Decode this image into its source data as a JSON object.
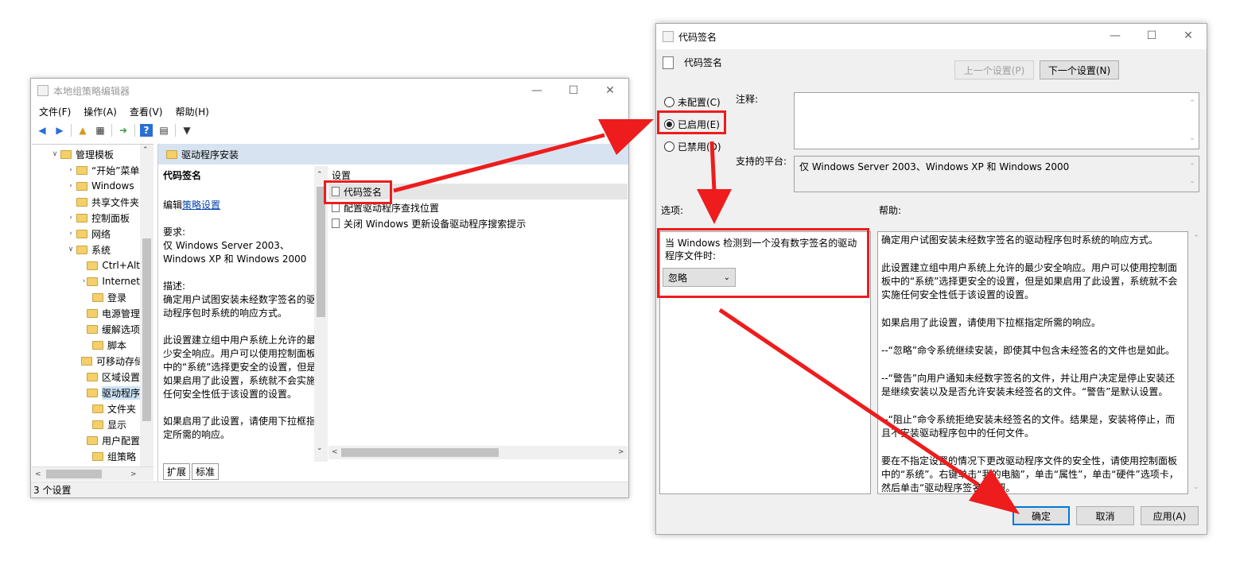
{
  "gpe": {
    "title": "本地组策略编辑器",
    "menu": [
      "文件(F)",
      "操作(A)",
      "查看(V)",
      "帮助(H)"
    ],
    "tree": [
      {
        "label": "管理模板",
        "arrow": "v",
        "level": 0
      },
      {
        "label": "“开始”菜单",
        "arrow": ">",
        "level": 1
      },
      {
        "label": "Windows",
        "arrow": ">",
        "level": 1
      },
      {
        "label": "共享文件夹",
        "arrow": "",
        "level": 1
      },
      {
        "label": "控制面板",
        "arrow": ">",
        "level": 1
      },
      {
        "label": "网络",
        "arrow": ">",
        "level": 1
      },
      {
        "label": "系统",
        "arrow": "v",
        "level": 1
      },
      {
        "label": "Ctrl+Alt",
        "arrow": "",
        "level": 2
      },
      {
        "label": "Internet",
        "arrow": ">",
        "level": 2
      },
      {
        "label": "登录",
        "arrow": "",
        "level": 2
      },
      {
        "label": "电源管理",
        "arrow": "",
        "level": 2
      },
      {
        "label": "缓解选项",
        "arrow": "",
        "level": 2
      },
      {
        "label": "脚本",
        "arrow": "",
        "level": 2
      },
      {
        "label": "可移动存储",
        "arrow": "",
        "level": 2
      },
      {
        "label": "区域设置",
        "arrow": "",
        "level": 2
      },
      {
        "label": "驱动程序",
        "arrow": "",
        "level": 2,
        "selected": true
      },
      {
        "label": "文件夹",
        "arrow": "",
        "level": 2
      },
      {
        "label": "显示",
        "arrow": "",
        "level": 2
      },
      {
        "label": "用户配置",
        "arrow": "",
        "level": 2
      },
      {
        "label": "组策略",
        "arrow": "",
        "level": 2
      }
    ],
    "pane_header": "驱动程序安装",
    "desc": {
      "title": "代码签名",
      "edit_prefix": "编辑",
      "edit_link": "策略设置",
      "req_label": "要求:",
      "req_text": "仅 Windows Server 2003、Windows XP 和 Windows 2000",
      "desc_label": "描述:",
      "desc_text": "确定用户试图安装未经数字签名的驱动程序包时系统的响应方式。",
      "para2": "此设置建立组中用户系统上允许的最少安全响应。用户可以使用控制面板中的“系统”选择更安全的设置，但是如果启用了此设置，系统就不会实施任何安全性低于该设置的设置。",
      "para3": "如果启用了此设置，请使用下拉框指定所需的响应。"
    },
    "list_header": "设置",
    "list_items": [
      "代码签名",
      "配置驱动程序查找位置",
      "关闭 Windows 更新设备驱动程序搜索提示"
    ],
    "tabs": [
      "扩展",
      "标准"
    ],
    "status": "3 个设置"
  },
  "dlg": {
    "title": "代码签名",
    "policy_name": "代码签名",
    "prev_btn": "上一个设置(P)",
    "next_btn": "下一个设置(N)",
    "radios": [
      "未配置(C)",
      "已启用(E)",
      "已禁用(D)"
    ],
    "comment_label": "注释:",
    "platform_label": "支持的平台:",
    "platform_text": "仅 Windows Server 2003、Windows XP 和 Windows 2000",
    "options_label": "选项:",
    "help_label": "帮助:",
    "option_text": "当 Windows 检测到一个没有数字签名的驱动程序文件时:",
    "option_select": "忽略",
    "help": [
      "确定用户试图安装未经数字签名的驱动程序包时系统的响应方式。",
      "此设置建立组中用户系统上允许的最少安全响应。用户可以使用控制面板中的“系统”选择更安全的设置，但是如果启用了此设置，系统就不会实施任何安全性低于该设置的设置。",
      "如果启用了此设置，请使用下拉框指定所需的响应。",
      "--“忽略”命令系统继续安装，即使其中包含未经签名的文件也是如此。",
      "--“警告”向用户通知未经数字签名的文件，并让用户决定是停止安装还是继续安装以及是否允许安装未经签名的文件。“警告”是默认设置。",
      "--“阻止”命令系统拒绝安装未经签名的文件。结果是，安装将停止，而且不安装驱动程序包中的任何文件。",
      "要在不指定设置的情况下更改驱动程序文件的安全性，请使用控制面板中的“系统”。右键单击“我的电脑”，单击“属性”，单击“硬件”选项卡，然后单击“驱动程序签名”按钮。"
    ],
    "ok_btn": "确定",
    "cancel_btn": "取消",
    "apply_btn": "应用(A)"
  }
}
